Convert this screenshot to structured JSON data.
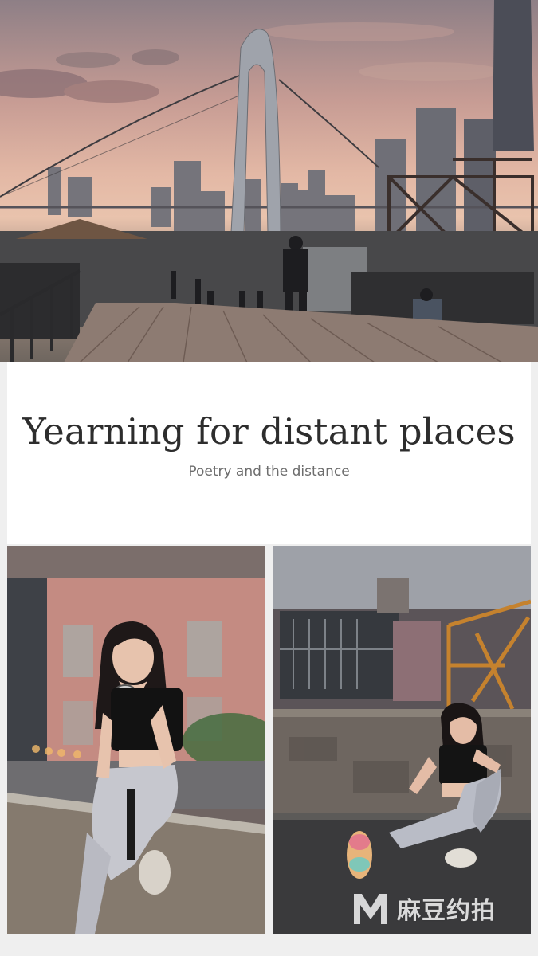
{
  "title": {
    "main": "Yearning for distant places",
    "subtitle": "Poetry and the distance"
  },
  "watermark": {
    "logo_letter": "M",
    "brand": "麻豆约拍"
  },
  "photos": [
    {
      "icon": "bridge-sunset-photo"
    },
    {
      "icon": "model-sitting-on-wall-photo"
    },
    {
      "icon": "model-rooftop-photo"
    }
  ],
  "colors": {
    "card_background": "#ffffff",
    "page_background": "#efefef",
    "title_text": "#2d2d2d",
    "subtitle_text": "#6d6d6d"
  }
}
